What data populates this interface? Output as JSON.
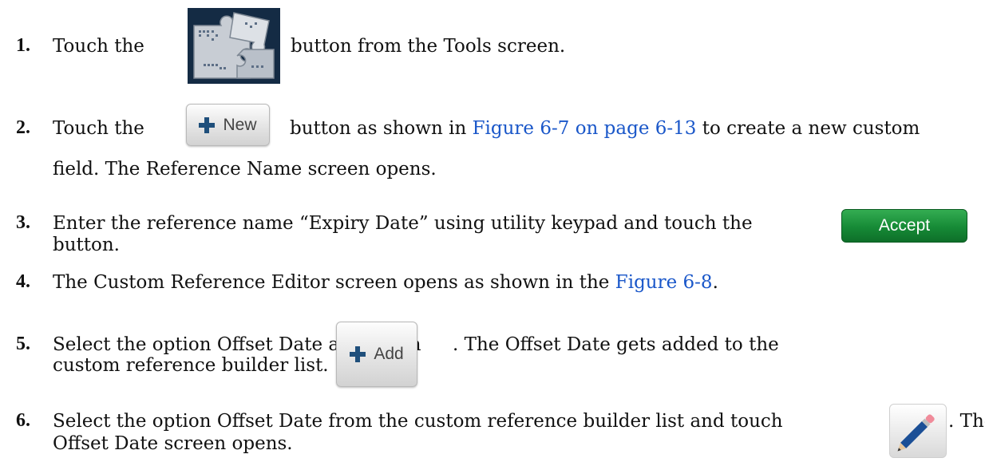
{
  "steps": [
    {
      "number": "1.",
      "before": "Touch the",
      "after": "button from the Tools screen."
    },
    {
      "number": "2.",
      "before": "Touch the",
      "button": "New",
      "middle": "button as shown in",
      "link": "Figure 6-7 on page 6-13",
      "after": "to create a new custom",
      "line2": "field. The Reference Name screen opens."
    },
    {
      "number": "3.",
      "text": "Enter the reference name “Expiry Date” using utility keypad and touch the",
      "button": "Accept",
      "line2": "button."
    },
    {
      "number": "4.",
      "before": "The Custom Reference Editor screen opens as shown in the",
      "link": "Figure 6-8",
      "after": "."
    },
    {
      "number": "5.",
      "before": "Select the option Offset Date and touch",
      "button": "Add",
      "after": ". The Offset Date gets added to the",
      "line2": "custom reference builder list."
    },
    {
      "number": "6.",
      "before": "Select the option Offset Date from the custom reference builder list and touch",
      "after": ". The",
      "line2": "Offset Date screen opens."
    }
  ],
  "icons": {
    "tools": "puzzle-pieces-tools-icon",
    "plus": "plus-icon",
    "pencil": "pencil-edit-icon"
  },
  "colors": {
    "link": "#1a57c9",
    "accept": "#168a36",
    "tools_bg": "#142b44"
  }
}
